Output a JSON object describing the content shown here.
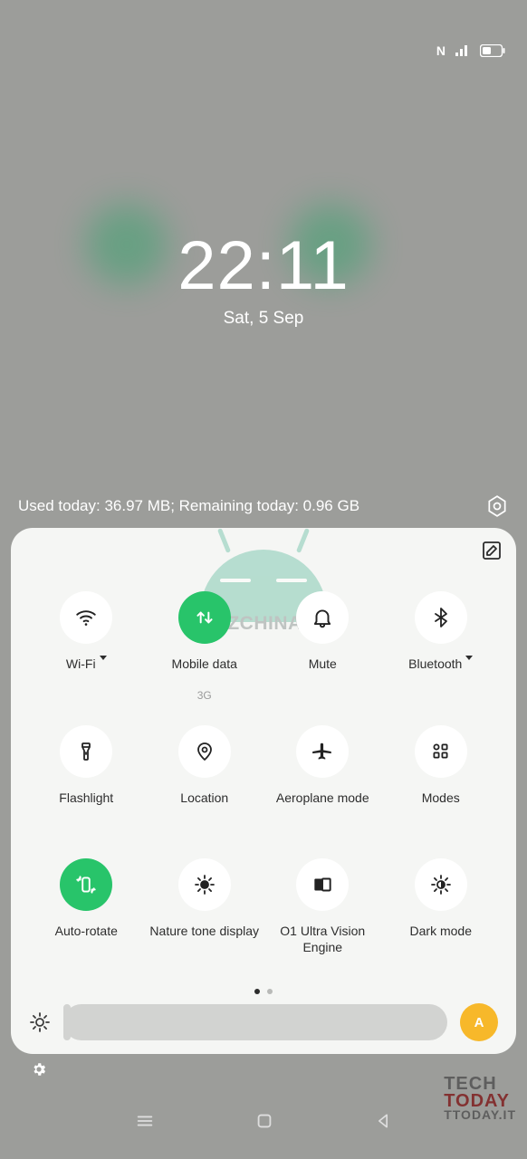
{
  "status": {
    "nfc": "N"
  },
  "clock": {
    "time": "22:11",
    "date": "Sat, 5 Sep"
  },
  "usage": {
    "text": "Used today: 36.97 MB; Remaining today: 0.96 GB"
  },
  "panel": {
    "watermark": "GIZCHINA.it",
    "tiles": [
      {
        "label": "Wi-Fi",
        "icon": "wifi",
        "active": false,
        "dropdown": true
      },
      {
        "label": "Mobile data",
        "sub": "3G",
        "icon": "mobiledata",
        "active": true
      },
      {
        "label": "Mute",
        "icon": "bell",
        "active": false
      },
      {
        "label": "Bluetooth",
        "icon": "bluetooth",
        "active": false,
        "dropdown": true
      },
      {
        "label": "Flashlight",
        "icon": "flashlight",
        "active": false
      },
      {
        "label": "Location",
        "icon": "location",
        "active": false
      },
      {
        "label": "Aeroplane mode",
        "icon": "airplane",
        "active": false
      },
      {
        "label": "Modes",
        "icon": "modes",
        "active": false
      },
      {
        "label": "Auto-rotate",
        "icon": "rotate",
        "active": true
      },
      {
        "label": "Nature tone display",
        "icon": "sun",
        "active": false
      },
      {
        "label": "O1 Ultra Vision Engine",
        "icon": "ultravision",
        "active": false
      },
      {
        "label": "Dark mode",
        "icon": "halfsun",
        "active": false
      }
    ],
    "pager": {
      "pages": 2,
      "active": 0
    },
    "autoLabel": "A"
  },
  "bottomWatermark": {
    "l1": "TECH",
    "l2": "TODAY",
    "l3": "TTODAY.IT"
  },
  "colors": {
    "accent": "#28c46a",
    "auto": "#f7b82a"
  }
}
